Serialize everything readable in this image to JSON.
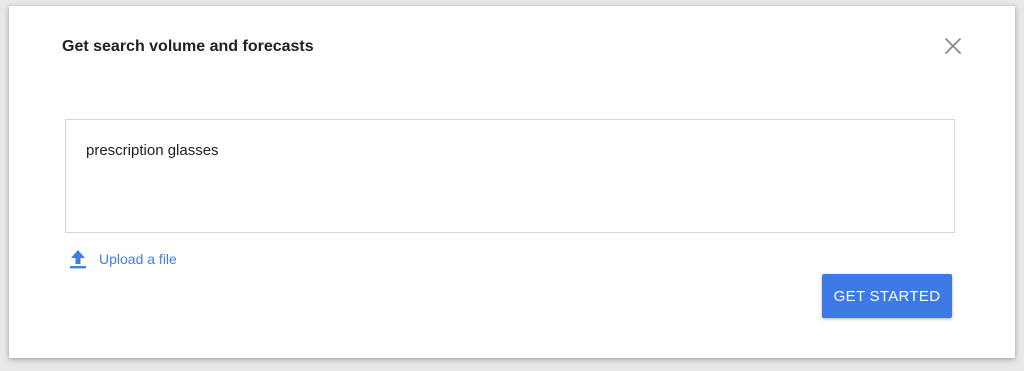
{
  "dialog": {
    "title": "Get search volume and forecasts",
    "close_icon": "close-icon"
  },
  "keywords_input": {
    "value": "prescription glasses"
  },
  "upload": {
    "icon": "upload-icon",
    "label": "Upload a file"
  },
  "actions": {
    "primary_label": "GET STARTED"
  },
  "colors": {
    "accent": "#3d7ae6",
    "link": "#3f7fe3"
  }
}
